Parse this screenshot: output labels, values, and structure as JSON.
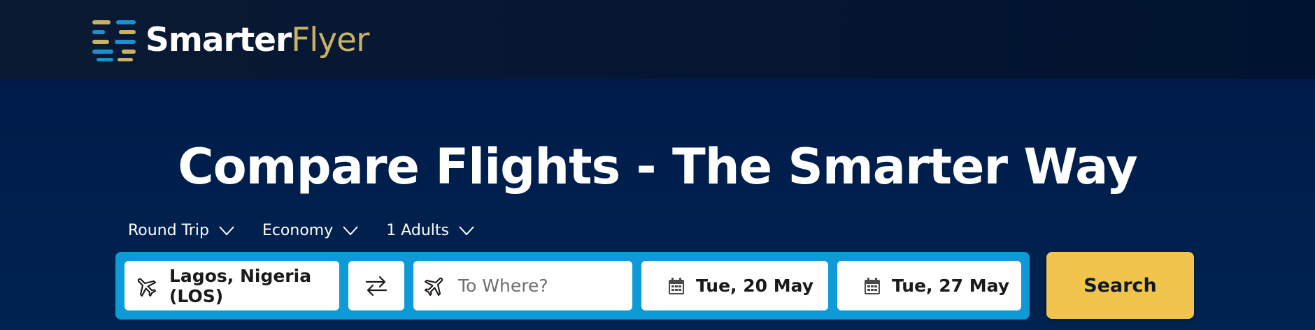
{
  "brand": {
    "name_part1": "Smarter",
    "name_part2": "Flyer",
    "accent_gold": "#c9b266",
    "accent_blue": "#0d9ad7"
  },
  "hero": {
    "headline": "Compare Flights - The Smarter Way"
  },
  "trip_options": {
    "trip_type": "Round Trip",
    "cabin_class": "Economy",
    "passengers": "1 Adults"
  },
  "search": {
    "from_value": "Lagos, Nigeria (LOS)",
    "to_placeholder": "To Where?",
    "departure_date": "Tue, 20 May",
    "return_date": "Tue, 27 May",
    "search_label": "Search",
    "search_button_color": "#f1c54d"
  },
  "icons": {
    "from": "airplane-icon",
    "swap": "swap-arrows-icon",
    "to": "airplane-icon",
    "departure": "calendar-icon",
    "return": "calendar-icon",
    "dropdown": "chevron-down-icon"
  }
}
